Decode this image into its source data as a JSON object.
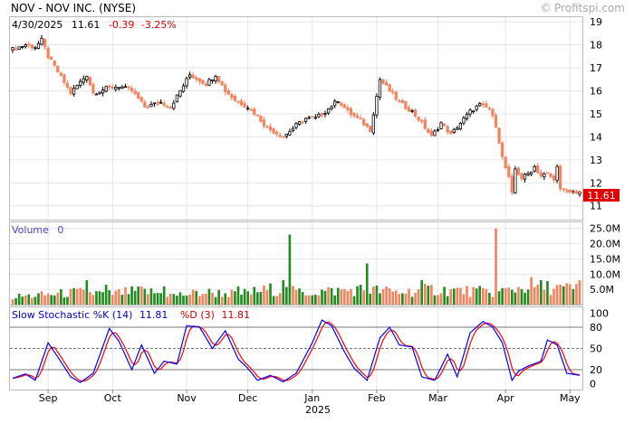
{
  "header": {
    "title": "NOV - NOV INC. (NYSE)",
    "watermark": "© Profitspi.com",
    "date": "4/30/2025",
    "close": "11.61",
    "change": "-0.39",
    "change_pct": "-3.25%"
  },
  "colors": {
    "up": "#ffffff",
    "down": "#f4845f",
    "vol_up": "#228b22",
    "vol_down": "#f4845f",
    "k_line": "#0000ff",
    "d_line": "#ff0000",
    "last_price_bg": "#e00000",
    "grid": "#e6e6e6",
    "change_text": "#cc0000"
  },
  "price_panel": {
    "ylim": [
      10.4,
      19.2
    ],
    "ticks": [
      "19",
      "18",
      "17",
      "16",
      "15",
      "14",
      "13",
      "12",
      "11"
    ],
    "last_label": "11.61"
  },
  "volume_panel": {
    "label": "Volume",
    "value": "0",
    "ylim": [
      0,
      27
    ],
    "ticks": [
      "25.0M",
      "20.0M",
      "15.0M",
      "10.0M",
      "5.0M"
    ]
  },
  "stoch_panel": {
    "label_k": "Slow Stochastic %K (14)",
    "value_k": "11.81",
    "label_d": "%D (3)",
    "value_d": "11.81",
    "ylim": [
      -8,
      108
    ],
    "ticks": [
      "100",
      "80",
      "50",
      "20",
      "0"
    ],
    "ref_lines": [
      80,
      50,
      20
    ]
  },
  "x_axis": {
    "months": [
      {
        "label": "Sep",
        "i": 11
      },
      {
        "label": "Oct",
        "i": 31
      },
      {
        "label": "Nov",
        "i": 54
      },
      {
        "label": "Dec",
        "i": 73
      },
      {
        "label": "Jan",
        "i": 93
      },
      {
        "label": "Feb",
        "i": 113
      },
      {
        "label": "Mar",
        "i": 132
      },
      {
        "label": "Apr",
        "i": 153
      },
      {
        "label": "May",
        "i": 173
      }
    ],
    "year_label": "2025"
  },
  "chart_data": {
    "type": "candlestick",
    "ticker": "NOV",
    "n_days": 177,
    "close_anchors": [
      [
        0,
        17.8
      ],
      [
        4,
        18.0
      ],
      [
        7,
        17.9
      ],
      [
        9,
        18.2
      ],
      [
        11,
        17.5
      ],
      [
        15,
        16.6
      ],
      [
        18,
        15.9
      ],
      [
        23,
        16.7
      ],
      [
        25,
        15.9
      ],
      [
        29,
        16.1
      ],
      [
        33,
        16.2
      ],
      [
        37,
        16.0
      ],
      [
        41,
        15.3
      ],
      [
        46,
        15.5
      ],
      [
        49,
        15.3
      ],
      [
        52,
        16.0
      ],
      [
        55,
        16.7
      ],
      [
        60,
        16.3
      ],
      [
        63,
        16.7
      ],
      [
        66,
        16.0
      ],
      [
        69,
        15.6
      ],
      [
        73,
        15.3
      ],
      [
        76,
        14.9
      ],
      [
        79,
        14.4
      ],
      [
        84,
        14.0
      ],
      [
        88,
        14.5
      ],
      [
        91,
        14.8
      ],
      [
        94,
        14.8
      ],
      [
        97,
        15.1
      ],
      [
        101,
        15.6
      ],
      [
        104,
        15.1
      ],
      [
        108,
        14.7
      ],
      [
        111,
        14.3
      ],
      [
        114,
        16.5
      ],
      [
        117,
        16.0
      ],
      [
        120,
        15.5
      ],
      [
        124,
        15.1
      ],
      [
        127,
        14.6
      ],
      [
        130,
        14.0
      ],
      [
        133,
        14.6
      ],
      [
        136,
        14.1
      ],
      [
        139,
        14.6
      ],
      [
        142,
        15.1
      ],
      [
        145,
        15.4
      ],
      [
        148,
        15.2
      ],
      [
        150,
        14.5
      ],
      [
        152,
        13.1
      ],
      [
        154,
        12.2
      ],
      [
        155,
        11.5
      ],
      [
        156,
        12.6
      ],
      [
        158,
        12.2
      ],
      [
        160,
        12.4
      ],
      [
        162,
        12.7
      ],
      [
        164,
        12.3
      ],
      [
        166,
        12.4
      ],
      [
        168,
        12.1
      ],
      [
        169,
        12.8
      ],
      [
        170,
        11.7
      ],
      [
        172,
        11.6
      ],
      [
        176,
        11.61
      ]
    ],
    "volume_anchors": [
      [
        0,
        2.5
      ],
      [
        10,
        3.2
      ],
      [
        20,
        4.0
      ],
      [
        30,
        3.5
      ],
      [
        40,
        4.5
      ],
      [
        50,
        3.0
      ],
      [
        60,
        4.0
      ],
      [
        70,
        3.5
      ],
      [
        80,
        5.0
      ],
      [
        90,
        4.0
      ],
      [
        100,
        4.5
      ],
      [
        110,
        5.0
      ],
      [
        120,
        4.0
      ],
      [
        130,
        5.0
      ],
      [
        140,
        4.5
      ],
      [
        150,
        4.0
      ],
      [
        160,
        6.0
      ],
      [
        170,
        5.5
      ],
      [
        176,
        5.0
      ]
    ],
    "volume_spikes": [
      [
        23,
        8
      ],
      [
        29,
        6.5
      ],
      [
        47,
        6
      ],
      [
        70,
        6
      ],
      [
        84,
        8
      ],
      [
        86,
        23
      ],
      [
        110,
        13.5
      ],
      [
        127,
        8
      ],
      [
        150,
        25
      ],
      [
        161,
        9
      ],
      [
        171,
        6
      ],
      [
        176,
        8
      ]
    ],
    "stoch_anchors": [
      [
        0,
        8
      ],
      [
        4,
        14
      ],
      [
        7,
        5
      ],
      [
        11,
        58
      ],
      [
        14,
        38
      ],
      [
        18,
        10
      ],
      [
        21,
        2
      ],
      [
        25,
        15
      ],
      [
        30,
        78
      ],
      [
        33,
        60
      ],
      [
        37,
        20
      ],
      [
        40,
        55
      ],
      [
        44,
        15
      ],
      [
        47,
        32
      ],
      [
        51,
        28
      ],
      [
        54,
        82
      ],
      [
        58,
        80
      ],
      [
        62,
        50
      ],
      [
        66,
        75
      ],
      [
        70,
        35
      ],
      [
        73,
        22
      ],
      [
        76,
        5
      ],
      [
        80,
        12
      ],
      [
        84,
        3
      ],
      [
        88,
        15
      ],
      [
        93,
        58
      ],
      [
        96,
        90
      ],
      [
        99,
        82
      ],
      [
        103,
        45
      ],
      [
        106,
        22
      ],
      [
        110,
        5
      ],
      [
        114,
        65
      ],
      [
        117,
        80
      ],
      [
        120,
        55
      ],
      [
        124,
        52
      ],
      [
        127,
        10
      ],
      [
        131,
        5
      ],
      [
        135,
        42
      ],
      [
        138,
        10
      ],
      [
        142,
        72
      ],
      [
        146,
        88
      ],
      [
        149,
        80
      ],
      [
        152,
        58
      ],
      [
        155,
        5
      ],
      [
        157,
        18
      ],
      [
        160,
        25
      ],
      [
        164,
        32
      ],
      [
        166,
        62
      ],
      [
        169,
        55
      ],
      [
        172,
        15
      ],
      [
        176,
        12
      ]
    ],
    "d_lag": 2
  }
}
